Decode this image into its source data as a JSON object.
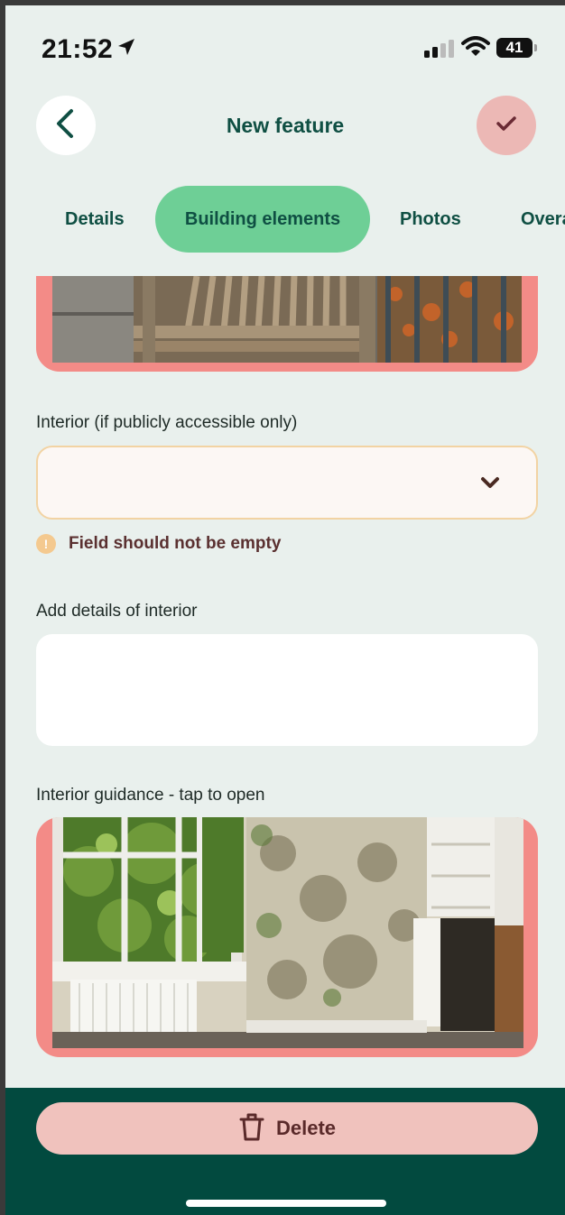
{
  "status_bar": {
    "time": "21:52",
    "battery": "41",
    "icons": [
      "location-arrow-icon",
      "cellular-signal-icon",
      "wifi-icon",
      "battery-icon"
    ]
  },
  "header": {
    "title": "New feature",
    "back_icon": "chevron-left-icon",
    "confirm_icon": "checkmark-icon"
  },
  "tabs": [
    {
      "label": "Details",
      "active": false
    },
    {
      "label": "Building elements",
      "active": true
    },
    {
      "label": "Photos",
      "active": false
    },
    {
      "label": "Overa",
      "active": false
    }
  ],
  "form": {
    "interior_label": "Interior (if publicly accessible only)",
    "interior_value": "",
    "warning_text": "Field should not be empty",
    "details_label": "Add details of interior",
    "details_value": "",
    "guidance_label": "Interior guidance - tap to open"
  },
  "footer": {
    "delete_label": "Delete",
    "delete_icon": "trash-icon"
  },
  "colors": {
    "background": "#e9f0ed",
    "primary_text": "#0f4f43",
    "active_tab": "#6ecf96",
    "confirm_button": "#ecb8b5",
    "card_border": "#f38b87",
    "warning": "#f4c98f",
    "bottom_bar": "#024a3f",
    "delete_button": "#f0c2bd"
  }
}
